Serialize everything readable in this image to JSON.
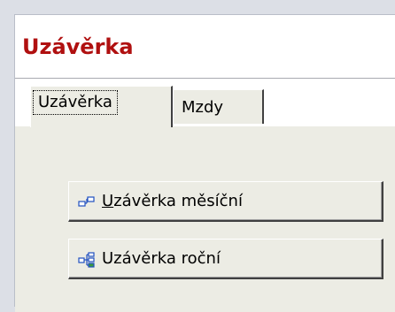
{
  "window": {
    "title": "Uzávěrka",
    "title_color": "#b01010"
  },
  "tabs": [
    {
      "label": "Uzávěrka",
      "active": true
    },
    {
      "label": "Mzdy",
      "active": false
    }
  ],
  "buttons": {
    "monthly": {
      "label": "Uzávěrka měsíční",
      "icon": "tree-nodes-icon"
    },
    "yearly": {
      "label": "Uzávěrka roční",
      "icon": "tree-hierarchy-icon"
    }
  }
}
